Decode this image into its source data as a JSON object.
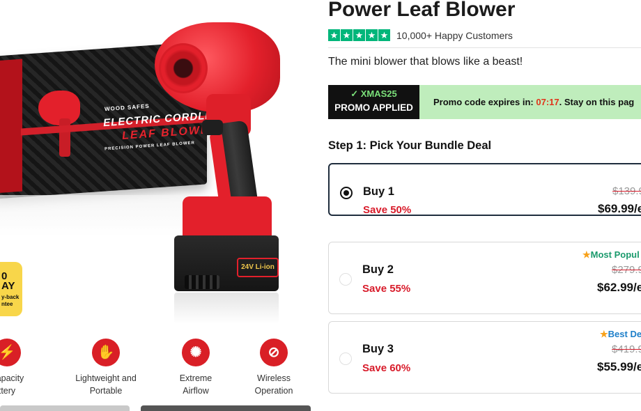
{
  "product": {
    "title": "Power Leaf Blower",
    "rating_text": "10,000+ Happy Customers",
    "star_count": 5,
    "star_color": "#00b67a",
    "tagline": "The mini blower that blows like a beast!"
  },
  "hero": {
    "box_brand": "WOOD SAFES",
    "box_title": "ELECTRIC CORDLESS",
    "box_title2": "LEAF BLOWER",
    "box_sub": "PRECISION POWER LEAF BLOWER",
    "battery_label": "24V Li-ion",
    "badge_line1": "0\nAY",
    "badge_line2": "y-back\nntee"
  },
  "features": [
    {
      "icon": "battery-icon",
      "glyph": "⚡",
      "label": "Capacity\nttery"
    },
    {
      "icon": "hand-icon",
      "glyph": "✋",
      "label": "Lightweight and\nPortable"
    },
    {
      "icon": "airflow-icon",
      "glyph": "✺",
      "label": "Extreme\nAirflow"
    },
    {
      "icon": "wireless-icon",
      "glyph": "⊘",
      "label": "Wireless\nOperation"
    }
  ],
  "promo": {
    "check": "✓",
    "code": "XMAS25",
    "applied": "PROMO APPLIED",
    "timer_prefix": "Promo code expires in: ",
    "time": "07:17",
    "timer_suffix": ".  Stay on this pag",
    "bg_color": "#bfedbc",
    "time_color": "#e0341b"
  },
  "step_title": "Step 1: Pick Your Bundle Deal",
  "offers": [
    {
      "name": "Buy 1",
      "save": "Save 50%",
      "old_price": "$139.9",
      "price": "$69.99/e",
      "badge": "",
      "selected": true
    },
    {
      "name": "Buy 2",
      "save": "Save 55%",
      "old_price": "$279.9",
      "price": "$62.99/e",
      "badge": "Most Popul",
      "selected": false
    },
    {
      "name": "Buy 3",
      "save": "Save 60%",
      "old_price": "$419.9",
      "price": "$55.99/e",
      "badge": "Best De",
      "selected": false
    }
  ],
  "colors": {
    "accent_red": "#d81b2a",
    "most_popular": "#1a9a6c",
    "best_deal": "#1e7fc9"
  }
}
